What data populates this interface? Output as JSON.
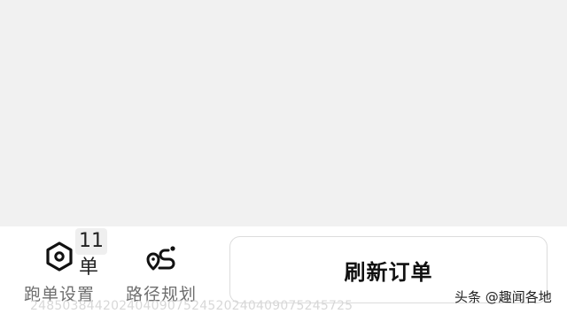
{
  "bottom_nav": {
    "order_settings": {
      "label": "跑单设置",
      "badge": "11单",
      "icon": "hexagon-settings-icon"
    },
    "route_planning": {
      "label": "路径规划",
      "icon": "route-pin-icon"
    }
  },
  "refresh_button": {
    "label": "刷新订单"
  },
  "footer_id": "24850384420240409075245202404090752457​25",
  "source_tag": "头条 @趣闻各地"
}
